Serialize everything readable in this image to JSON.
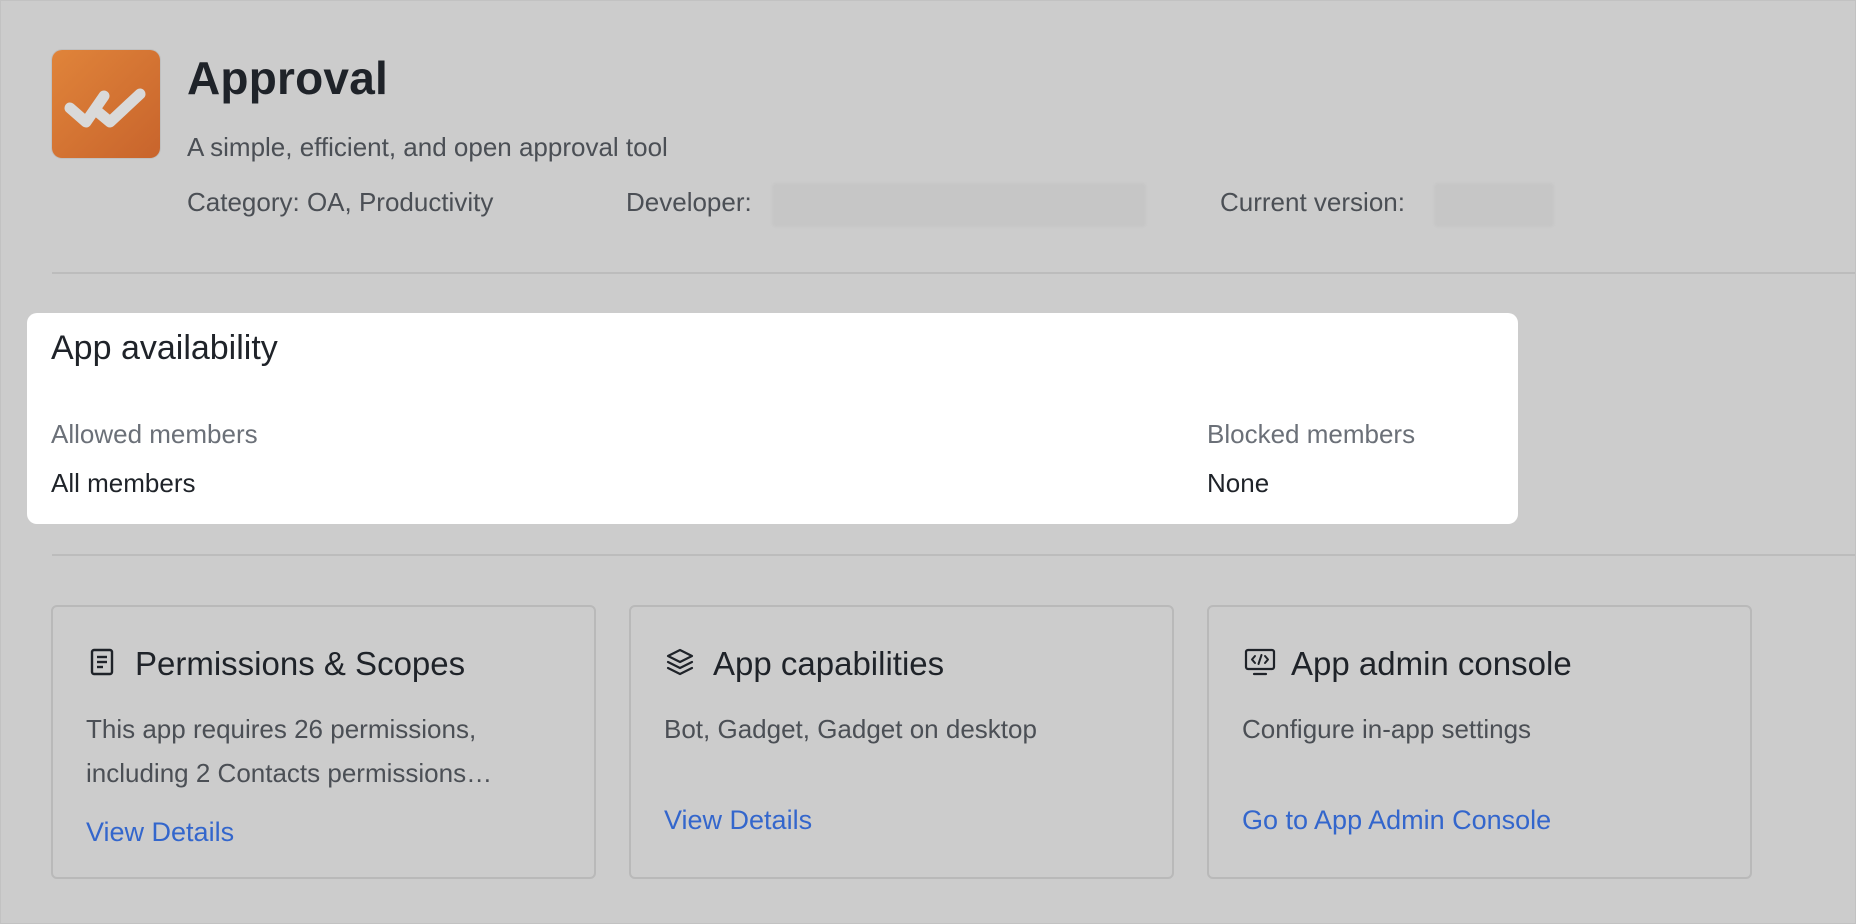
{
  "app": {
    "title": "Approval",
    "subtitle": "A simple, efficient, and open approval tool",
    "category": "Category: OA, Productivity",
    "developer_label": "Developer:",
    "version_label": "Current version:",
    "icon": "double-check-icon",
    "icon_color": "#d4743a"
  },
  "availability": {
    "heading": "App availability",
    "allowed_label": "Allowed members",
    "allowed_value": "All members",
    "blocked_label": "Blocked members",
    "blocked_value": "None"
  },
  "cards": [
    {
      "icon": "document-list-icon",
      "title": "Permissions & Scopes",
      "description": "This app requires 26 permissions, including 2 Contacts permissions…",
      "link": "View Details"
    },
    {
      "icon": "layers-icon",
      "title": "App capabilities",
      "description": "Bot, Gadget, Gadget on desktop",
      "link": "View Details"
    },
    {
      "icon": "admin-console-icon",
      "title": "App admin console",
      "description": "Configure in-app settings",
      "link": "Go to App Admin Console"
    }
  ],
  "colors": {
    "backdrop": "#cccccc",
    "link": "#3366cc",
    "text_primary": "#1f2329",
    "text_secondary": "#4b4f55"
  }
}
